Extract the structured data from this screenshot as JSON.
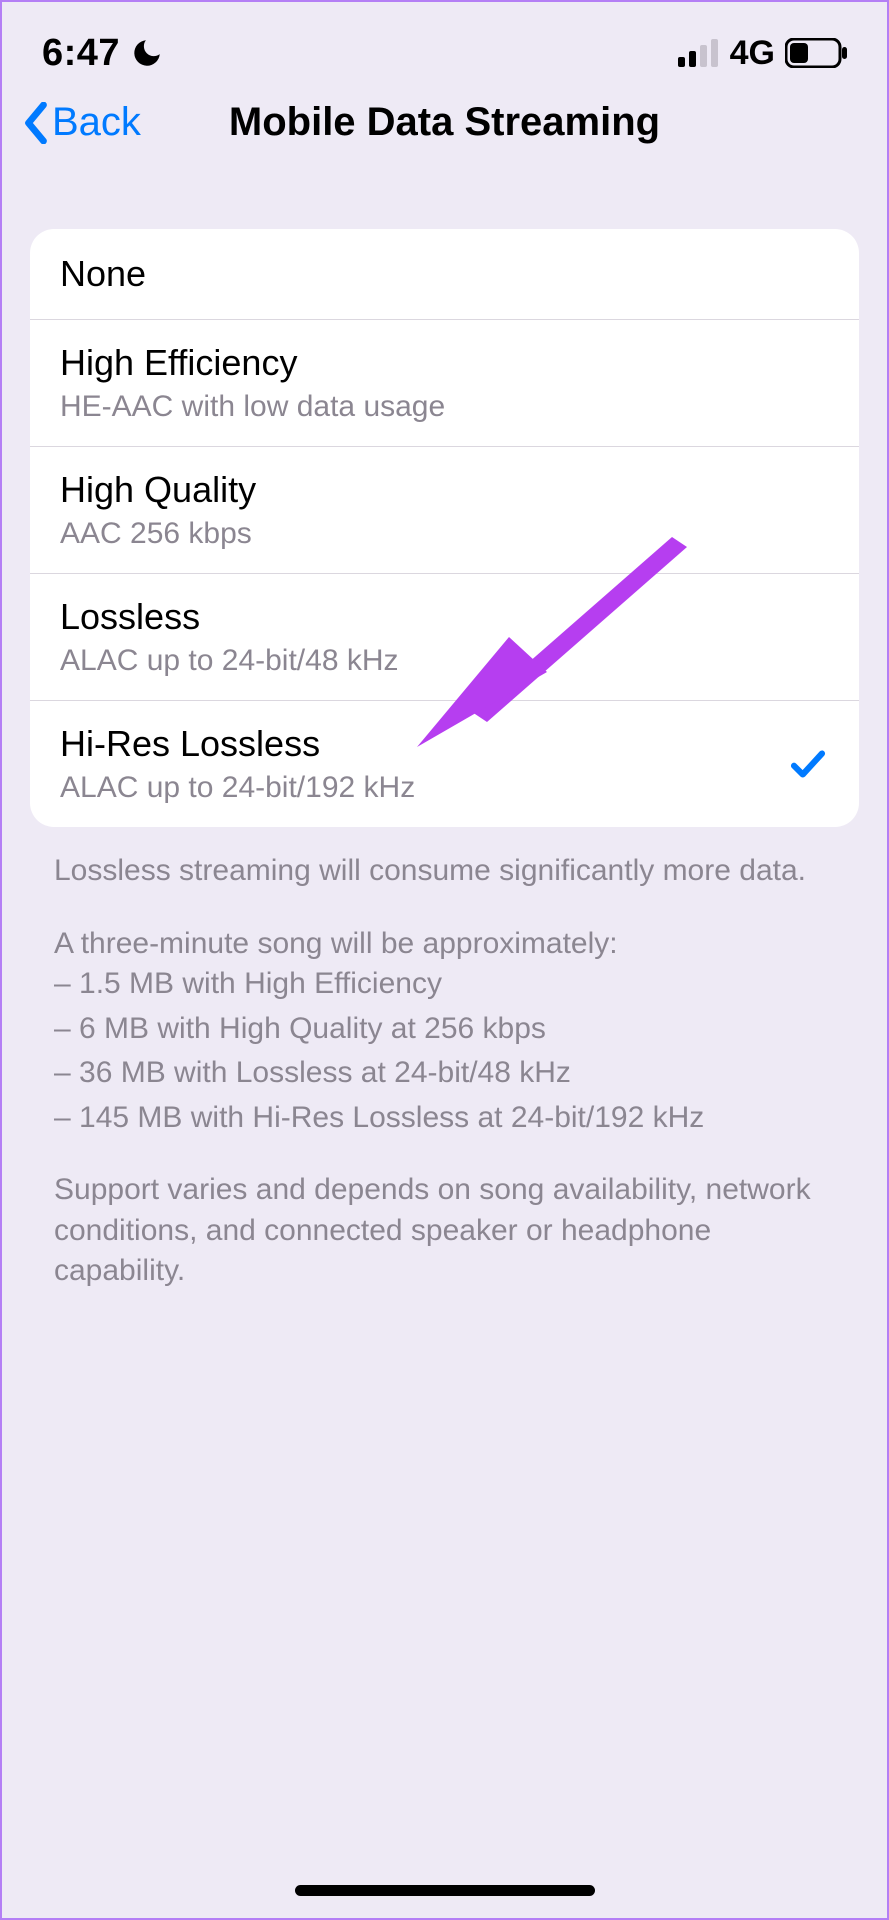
{
  "status_bar": {
    "time": "6:47",
    "network": "4G"
  },
  "nav": {
    "back_label": "Back",
    "title": "Mobile Data Streaming"
  },
  "options": [
    {
      "title": "None",
      "sub": "",
      "selected": false
    },
    {
      "title": "High Efficiency",
      "sub": "HE-AAC with low data usage",
      "selected": false
    },
    {
      "title": "High Quality",
      "sub": "AAC 256 kbps",
      "selected": false
    },
    {
      "title": "Lossless",
      "sub": "ALAC up to 24-bit/48 kHz",
      "selected": false
    },
    {
      "title": "Hi-Res Lossless",
      "sub": "ALAC up to 24-bit/192 kHz",
      "selected": true
    }
  ],
  "footer": {
    "p1": "Lossless streaming will consume significantly more data.",
    "p2_intro": "A three-minute song will be approximately:",
    "p2_lines": [
      "– 1.5 MB with High Efficiency",
      "– 6 MB with High Quality at 256 kbps",
      "– 36 MB with Lossless at 24-bit/48 kHz",
      "– 145 MB with Hi-Res Lossless at 24-bit/192 kHz"
    ],
    "p3": "Support varies and depends on song availability, network conditions, and connected speaker or headphone capability."
  }
}
